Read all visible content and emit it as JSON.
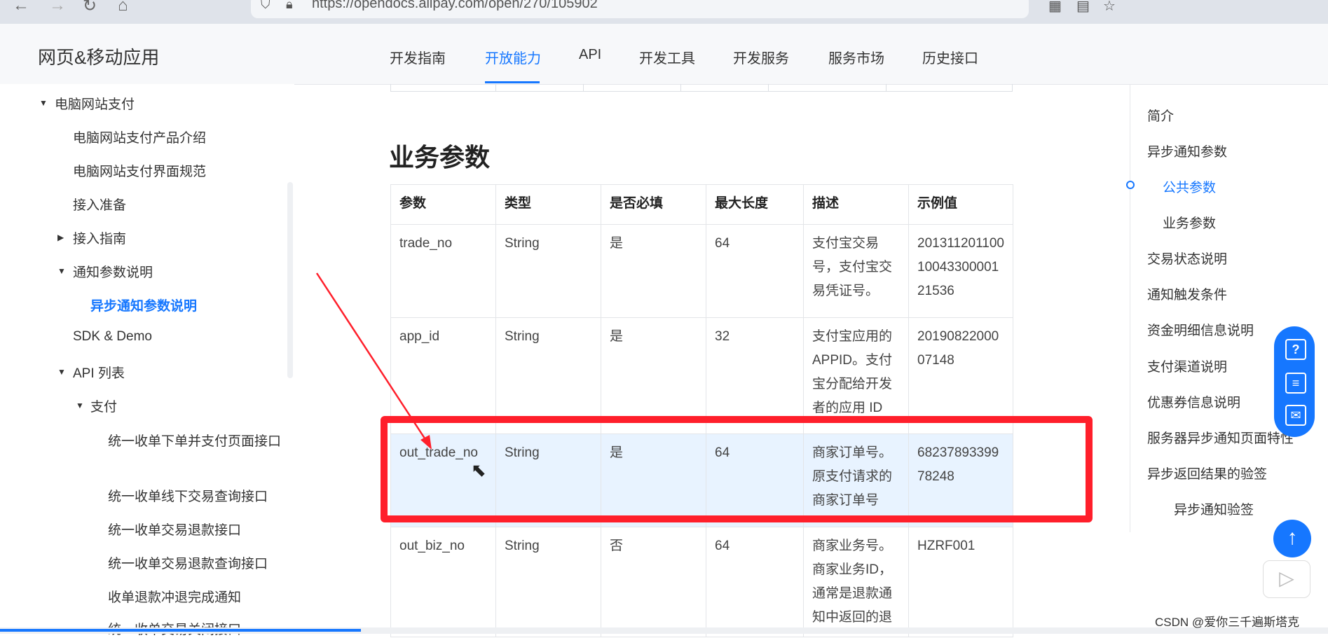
{
  "browser": {
    "url": "https://opendocs.alipay.com/open/270/105902",
    "back_icon": "arrow-left-icon",
    "forward_icon": "arrow-right-icon",
    "reload_icon": "reload-icon",
    "home_icon": "home-icon"
  },
  "header": {
    "title": "网页&移动应用",
    "tabs": [
      "开发指南",
      "开放能力",
      "API",
      "开发工具",
      "开发服务",
      "服务市场",
      "历史接口"
    ],
    "active_tab": "开放能力"
  },
  "sidebar": {
    "items": [
      "电脑网站支付",
      "电脑网站支付产品介绍",
      "电脑网站支付界面规范",
      "接入准备",
      "接入指南",
      "通知参数说明",
      "异步通知参数说明",
      "SDK & Demo",
      "API 列表",
      "支付",
      "统一收单下单并支付页面接口",
      "统一收单线下交易查询接口",
      "统一收单交易退款接口",
      "统一收单交易退款查询接口",
      "收单退款冲退完成通知",
      "统一收单交易关闭接口"
    ],
    "active_item": "异步通知参数说明"
  },
  "main": {
    "section_title": "业务参数",
    "table": {
      "headers": [
        "参数",
        "类型",
        "是否必填",
        "最大长度",
        "描述",
        "示例值"
      ],
      "rows": [
        [
          "trade_no",
          "String",
          "是",
          "64",
          "支付宝交易号，支付宝交易凭证号。",
          "2013112011001004330000121536"
        ],
        [
          "app_id",
          "String",
          "是",
          "32",
          "支付宝应用的APPID。支付宝分配给开发者的应用 ID",
          "2019082200007148"
        ],
        [
          "out_trade_no",
          "String",
          "是",
          "64",
          "商家订单号。原支付请求的商家订单号",
          "6823789339978248"
        ],
        [
          "out_biz_no",
          "String",
          "否",
          "64",
          "商家业务号。商家业务ID，通常是退款通知中返回的退",
          "HZRF001"
        ]
      ],
      "highlighted_row": 2
    }
  },
  "toc": {
    "items": [
      "简介",
      "异步通知参数",
      "公共参数",
      "业务参数",
      "交易状态说明",
      "通知触发条件",
      "资金明细信息说明",
      "支付渠道说明",
      "优惠券信息说明",
      "服务器异步通知页面特性",
      "异步返回结果的验签",
      "异步通知验签"
    ],
    "active_item": "公共参数"
  },
  "float_buttons": {
    "icons": [
      "help-icon",
      "chat-icon",
      "feedback-icon"
    ],
    "back_to_top_icon": "arrow-up-icon",
    "video_icon": "play-icon"
  },
  "watermark": "CSDN @爱你三千遍斯塔克",
  "colors": {
    "accent": "#1677ff",
    "annotation": "#ff1f2b",
    "highlight_row": "#e8f3ff"
  }
}
